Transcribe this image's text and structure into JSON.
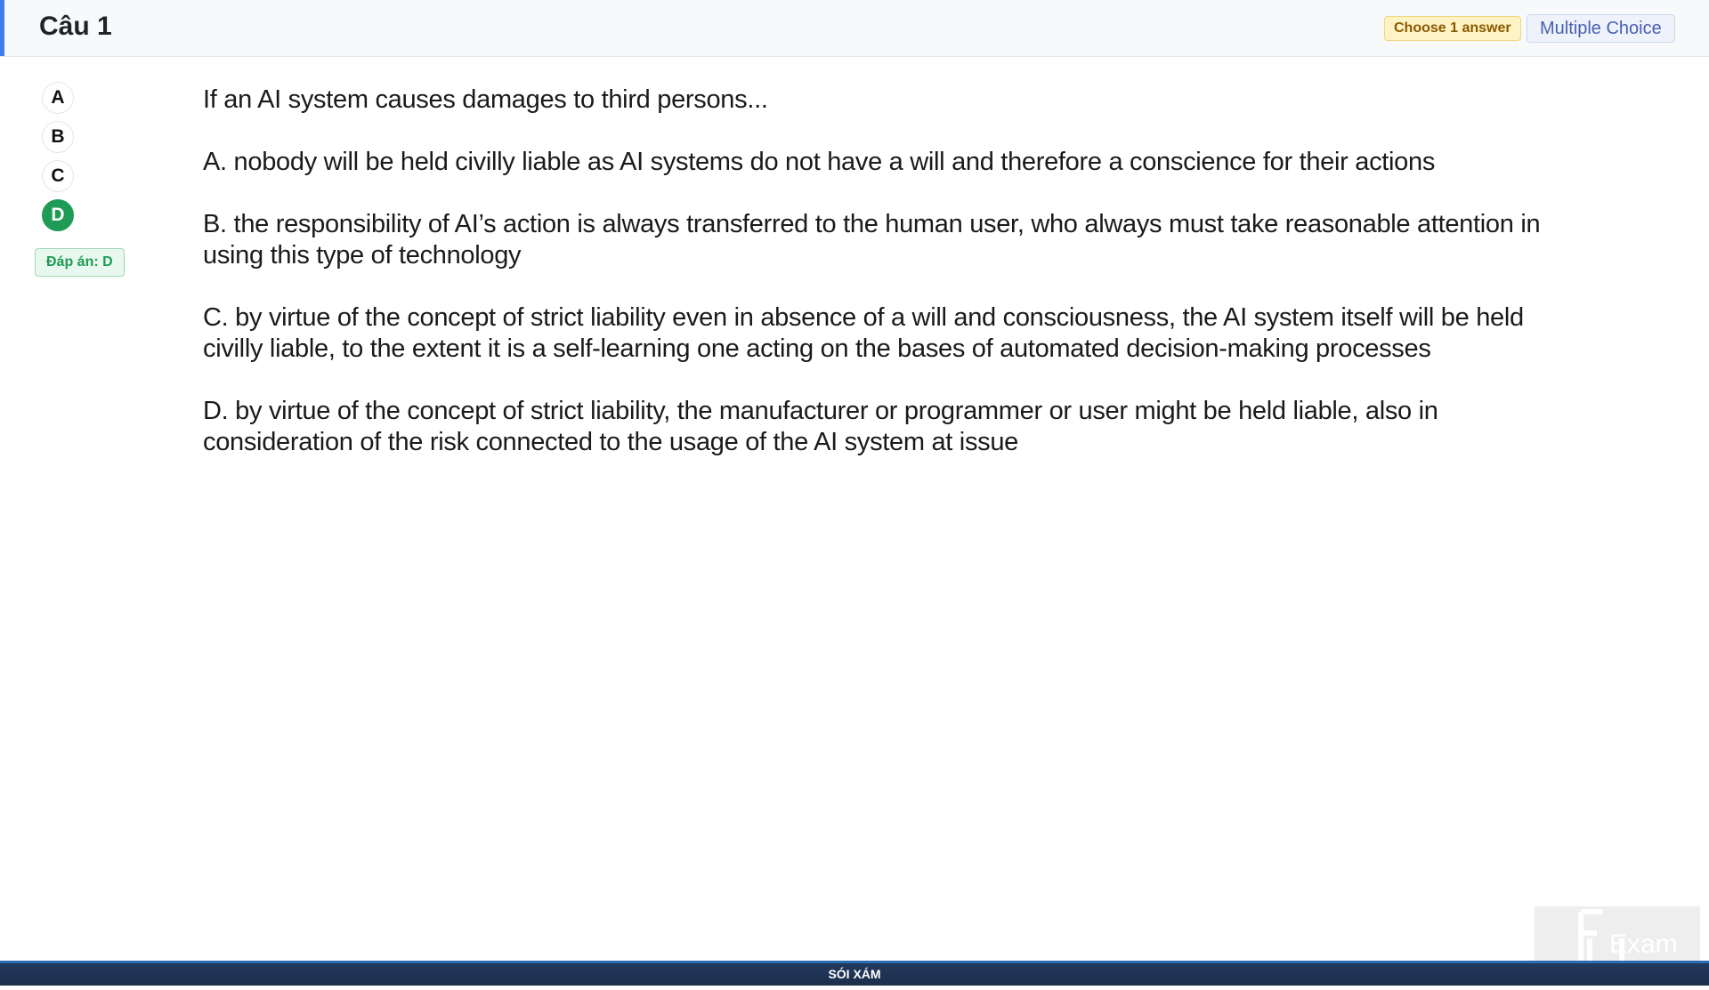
{
  "header": {
    "title": "Câu 1",
    "choose_badge": "Choose 1 answer",
    "type_badge": "Multiple Choice"
  },
  "options": [
    "A",
    "B",
    "C",
    "D"
  ],
  "selected_option": "D",
  "answer_label": "Đáp án: D",
  "question": {
    "stem": "If an AI system causes damages to third persons...",
    "choices": [
      "A.  nobody will be held civilly liable as AI systems do not have a will and therefore a conscience for their actions",
      "B.  the responsibility of AI’s action is always transferred to the human user, who always must take reasonable attention in using this type of technology",
      "C.  by virtue of the concept of strict liability even in absence of a will and consciousness, the AI system itself will be held civilly liable, to the extent it is a self-learning one acting on the bases of automated decision-making processes",
      "D.  by virtue of the concept of strict liability, the manufacturer or programmer or user might be held liable, also in consideration of the risk connected to the usage of the AI system at issue"
    ]
  },
  "footer": {
    "text": "SÓI XÁM"
  },
  "logo": {
    "text": "Exam",
    "icon": "fu-exam-logo-icon"
  },
  "colors": {
    "accent": "#3f7ee8",
    "correct": "#1e9b55",
    "footer": "#1b2e4b"
  }
}
